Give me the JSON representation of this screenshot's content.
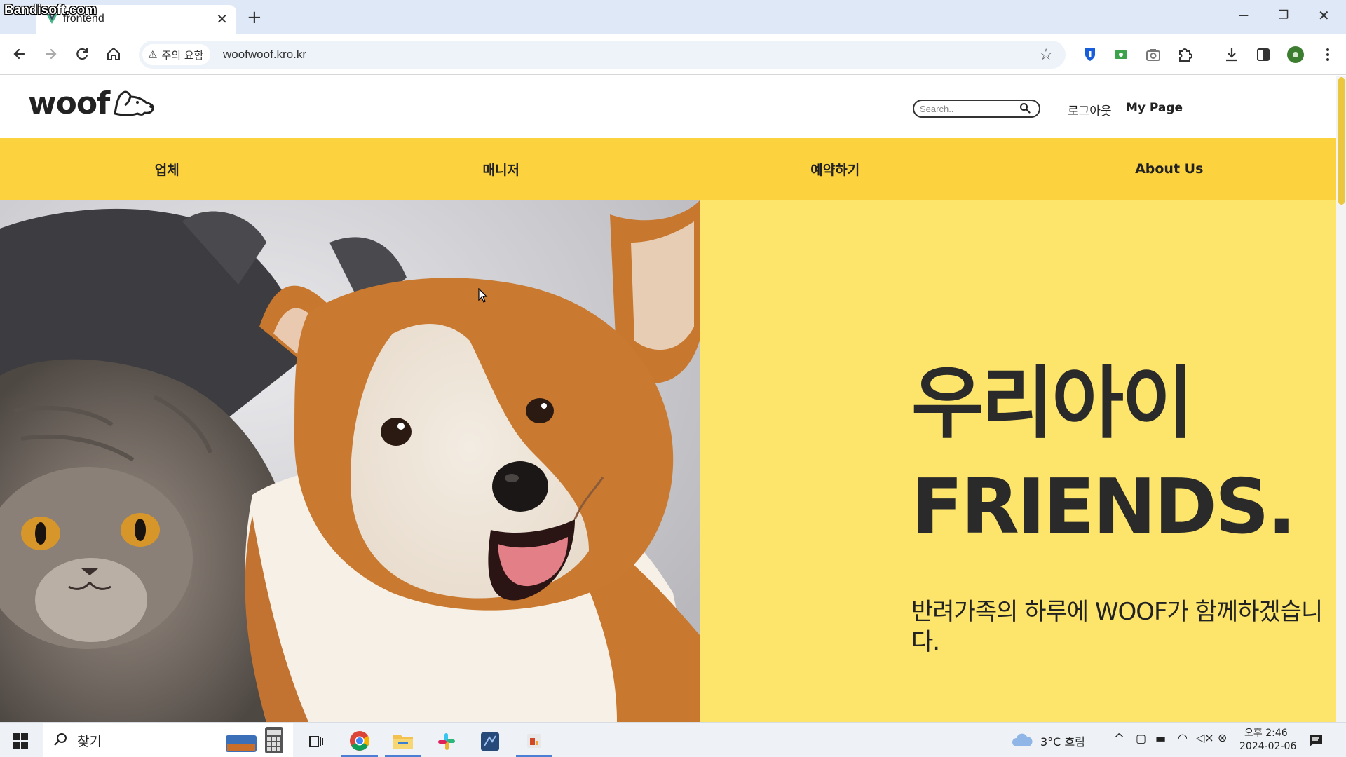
{
  "watermark": "Bandisoft.com",
  "browser": {
    "tab_title": "frontend",
    "new_tab": "+",
    "security_label": "주의 요함",
    "url": "woofwoof.kro.kr"
  },
  "site": {
    "logo_text": "woof",
    "search_placeholder": "Search..",
    "logout_label": "로그아웃",
    "mypage_label": "My Page",
    "nav": [
      {
        "label": "업체"
      },
      {
        "label": "매니저"
      },
      {
        "label": "예약하기"
      },
      {
        "label": "About Us"
      }
    ],
    "hero": {
      "line1": "우리아이",
      "line2": "FRIENDS.",
      "subtitle": "반려가족의 하루에 WOOF가 함께하겠습니다."
    },
    "colors": {
      "nav_bg": "#fcd33f",
      "hero_bg": "#fde56c",
      "text": "#2a2a2a"
    }
  },
  "taskbar": {
    "search_label": "찾기",
    "weather": "3°C  흐림",
    "time": "오후 2:46",
    "date": "2024-02-06",
    "apps": [
      "calculator-app",
      "task-view",
      "chrome",
      "file-explorer",
      "slack",
      "vscode",
      "powerpoint"
    ]
  }
}
